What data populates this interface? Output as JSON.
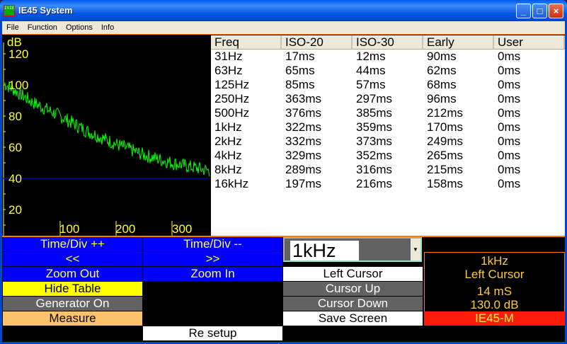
{
  "window": {
    "title": "IE45 System",
    "icon_text": "IVIE"
  },
  "menu": [
    "File",
    "Function",
    "Options",
    "Info"
  ],
  "graph": {
    "y_unit": "dB",
    "y_ticks": [
      "120",
      "100",
      "80",
      "60",
      "40",
      "20"
    ],
    "x_ticks": [
      "100",
      "200",
      "300"
    ],
    "cursor_db": 40,
    "trace_color": "#00ff00",
    "cursor_color": "#0000ff",
    "trace_trend_db": [
      {
        "x": 0,
        "db": 101
      },
      {
        "x": 50,
        "db": 89
      },
      {
        "x": 100,
        "db": 80
      },
      {
        "x": 150,
        "db": 70
      },
      {
        "x": 200,
        "db": 62
      },
      {
        "x": 250,
        "db": 55
      },
      {
        "x": 300,
        "db": 50
      },
      {
        "x": 365,
        "db": 45
      }
    ]
  },
  "table": {
    "headers": [
      "Freq",
      "ISO-20",
      "ISO-30",
      "Early",
      "User"
    ],
    "rows": [
      [
        "31Hz",
        "17ms",
        "12ms",
        "90ms",
        "0ms"
      ],
      [
        "63Hz",
        "65ms",
        "44ms",
        "62ms",
        "0ms"
      ],
      [
        "125Hz",
        "85ms",
        "57ms",
        "68ms",
        "0ms"
      ],
      [
        "250Hz",
        "363ms",
        "297ms",
        "96ms",
        "0ms"
      ],
      [
        "500Hz",
        "376ms",
        "385ms",
        "212ms",
        "0ms"
      ],
      [
        "1kHz",
        "322ms",
        "359ms",
        "170ms",
        "0ms"
      ],
      [
        "2kHz",
        "332ms",
        "373ms",
        "249ms",
        "0ms"
      ],
      [
        "4kHz",
        "329ms",
        "352ms",
        "265ms",
        "0ms"
      ],
      [
        "8kHz",
        "289ms",
        "316ms",
        "215ms",
        "0ms"
      ],
      [
        "16kHz",
        "197ms",
        "216ms",
        "158ms",
        "0ms"
      ]
    ]
  },
  "buttons": {
    "time_div_up": "Time/Div ++",
    "time_div_down": "Time/Div --",
    "prev": "<<",
    "next": ">>",
    "zoom_out": "Zoom Out",
    "zoom_in": "Zoom In",
    "hide_table": "Hide Table",
    "generator": "Generator On",
    "measure": "Measure",
    "re_setup": "Re setup",
    "left_cursor": "Left Cursor",
    "cursor_up": "Cursor Up",
    "cursor_down": "Cursor Down",
    "save_screen": "Save Screen",
    "model": "IE45-M"
  },
  "band_select": {
    "value": "1kHz"
  },
  "info": {
    "band": "1kHz",
    "cursor": "Left Cursor",
    "time": "14 mS",
    "level": "130.0 dB"
  }
}
